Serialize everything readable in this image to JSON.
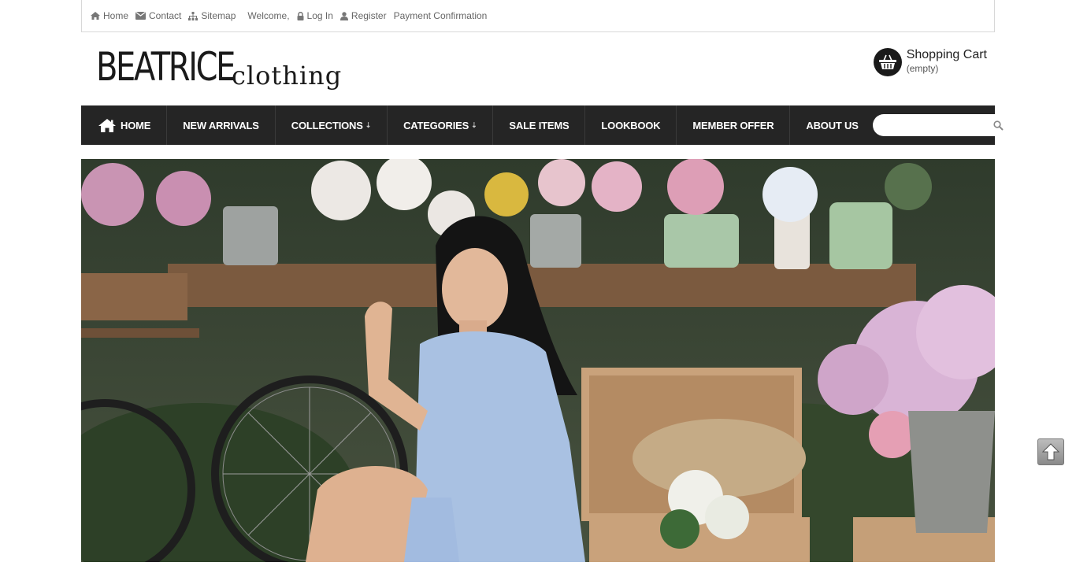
{
  "topbar": {
    "home": "Home",
    "contact": "Contact",
    "sitemap": "Sitemap",
    "welcome": "Welcome,",
    "login": "Log In",
    "register": "Register",
    "payment": "Payment Confirmation"
  },
  "logo": {
    "main": "BEATRICE",
    "sub": "clothing"
  },
  "cart": {
    "title": "Shopping Cart",
    "status": "(empty)"
  },
  "nav": {
    "home": "HOME",
    "new_arrivals": "NEW ARRIVALS",
    "collections": "COLLECTIONS",
    "categories": "CATEGORIES",
    "sale_items": "SALE ITEMS",
    "lookbook": "LOOKBOOK",
    "member_offer": "MEMBER OFFER",
    "about_us": "ABOUT US",
    "caret": "⇣"
  },
  "search": {
    "placeholder": ""
  },
  "colors": {
    "nav_bg": "#252525",
    "topbar_text": "#666666",
    "accent": "#1a1a1a"
  },
  "icons": [
    "home-icon",
    "envelope-icon",
    "sitemap-icon",
    "lock-icon",
    "user-icon",
    "basket-icon",
    "search-icon",
    "arrow-up-icon"
  ]
}
